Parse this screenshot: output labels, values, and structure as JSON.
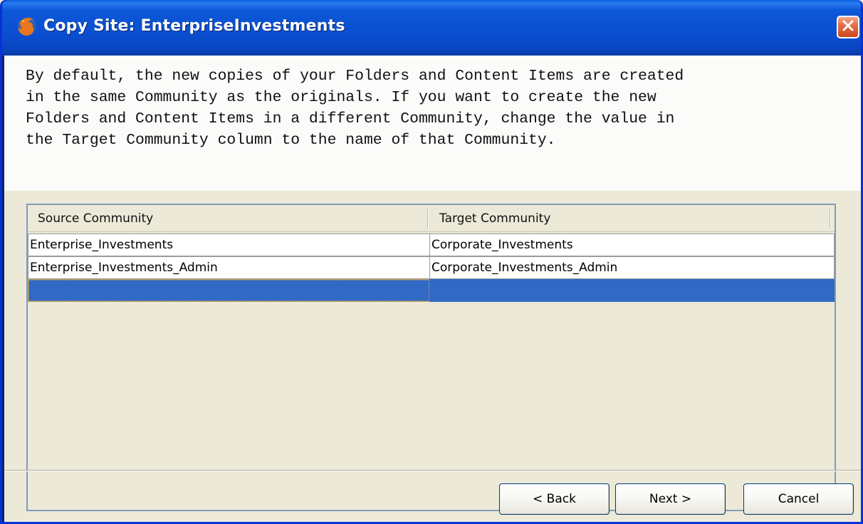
{
  "window": {
    "title": "Copy Site: EnterpriseInvestments",
    "close_label": "×"
  },
  "info": {
    "lines": [
      "By default, the new copies of your Folders and Content Items are created",
      "in the same Community as the originals. If you want to create the new",
      "Folders and Content Items in a different Community, change the value in",
      "the Target Community column to the name of that Community."
    ]
  },
  "table": {
    "columns": [
      "Source Community",
      "Target Community"
    ],
    "rows": [
      [
        "Enterprise_Investments",
        "Corporate_Investments"
      ],
      [
        "Enterprise_Investments_Admin",
        "Corporate_Investments_Admin"
      ],
      [
        "",
        ""
      ]
    ],
    "selected_row": 2
  },
  "buttons": {
    "back": "< Back",
    "next": "Next >",
    "cancel": "Cancel"
  },
  "colors": {
    "title_bar": "#0a4fd0",
    "selection": "#316ac5",
    "close_button": "#d1471f",
    "dialog_bg": "#ece9d8"
  },
  "icons": {
    "title": "firefox-icon",
    "close": "close-icon"
  }
}
